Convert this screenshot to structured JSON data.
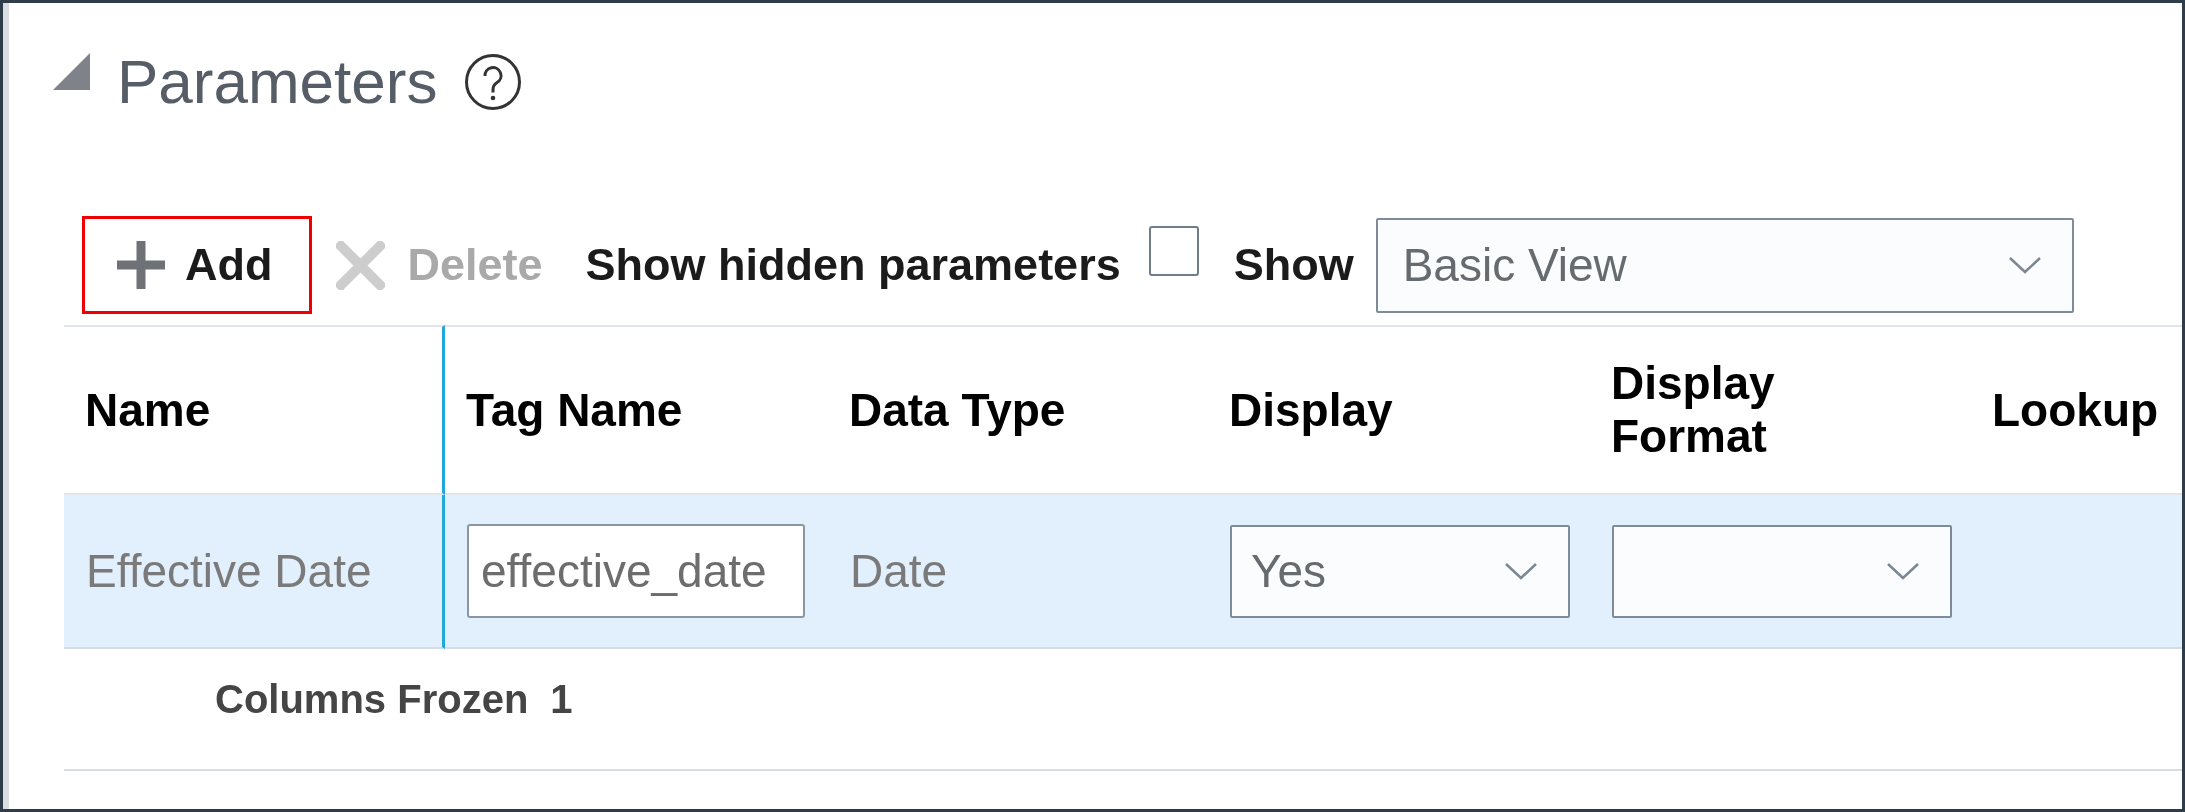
{
  "section": {
    "title": "Parameters",
    "expanded": true
  },
  "toolbar": {
    "buttons": [
      {
        "kind": "add",
        "label": "Add",
        "disabled": false,
        "highlighted": true
      },
      {
        "kind": "delete",
        "label": "Delete",
        "disabled": true,
        "highlighted": false
      }
    ],
    "show_hidden": {
      "label": "Show hidden parameters",
      "checked": false
    },
    "view": {
      "label": "Show",
      "value": "Basic View"
    }
  },
  "table": {
    "columns": [
      {
        "label": "Name",
        "frozen": true
      },
      {
        "label": "Tag Name",
        "frozen": false
      },
      {
        "label": "Data Type",
        "frozen": false
      },
      {
        "label": "Display",
        "frozen": false
      },
      {
        "label": "Display Format",
        "frozen": false
      },
      {
        "label": "Lookup",
        "frozen": false
      }
    ],
    "rows": [
      {
        "selected": true,
        "cells": [
          {
            "kind": "text",
            "value": "Effective Date"
          },
          {
            "kind": "input",
            "value": "effective_date"
          },
          {
            "kind": "text",
            "value": "Date"
          },
          {
            "kind": "select",
            "value": "Yes"
          },
          {
            "kind": "select"
          }
        ]
      }
    ]
  },
  "footer": {
    "label": "Columns Frozen",
    "value": "1"
  }
}
